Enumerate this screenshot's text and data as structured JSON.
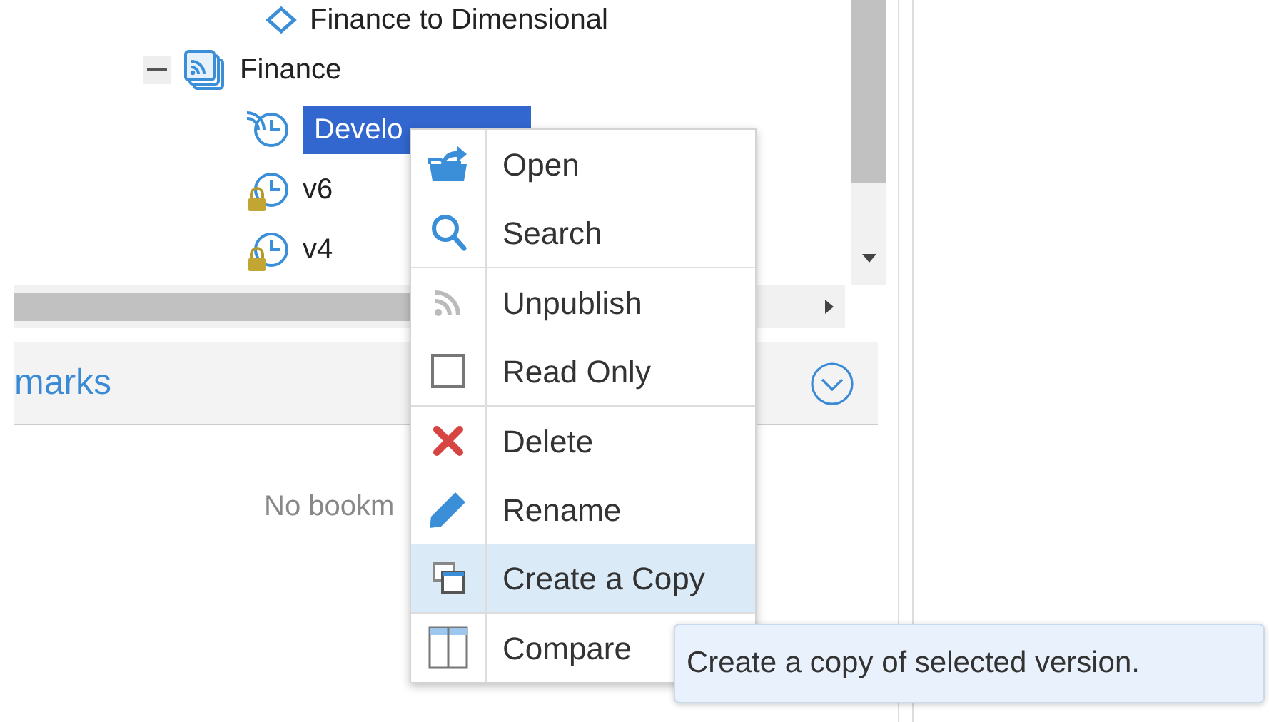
{
  "tree": [
    {
      "kind": "cube",
      "label": "Finance to Dimensional"
    },
    {
      "kind": "application",
      "label": "Finance",
      "expanded": true,
      "children": [
        {
          "kind": "version",
          "label": "Develo",
          "selected": true,
          "published": true,
          "locked": false
        },
        {
          "kind": "version",
          "label": "v6",
          "selected": false,
          "published": false,
          "locked": true
        },
        {
          "kind": "version",
          "label": "v4",
          "selected": false,
          "published": false,
          "locked": true
        }
      ]
    }
  ],
  "bookmarks": {
    "title": "marks",
    "empty_text": "No bookm"
  },
  "context_menu": {
    "groups": [
      [
        {
          "kind": "action",
          "label": "Open",
          "selected": false
        },
        {
          "kind": "action",
          "label": "Search",
          "selected": false
        }
      ],
      [
        {
          "kind": "action",
          "label": "Unpublish",
          "selected": false
        },
        {
          "kind": "checkbox",
          "label": "Read Only",
          "checked": false,
          "selected": false
        }
      ],
      [
        {
          "kind": "action",
          "label": "Delete",
          "selected": false
        },
        {
          "kind": "action",
          "label": "Rename",
          "selected": false
        },
        {
          "kind": "action",
          "label": "Create a Copy",
          "selected": true
        }
      ],
      [
        {
          "kind": "action",
          "label": "Compare",
          "selected": false
        }
      ]
    ]
  },
  "tooltip": {
    "text": "Create a copy of selected version."
  }
}
